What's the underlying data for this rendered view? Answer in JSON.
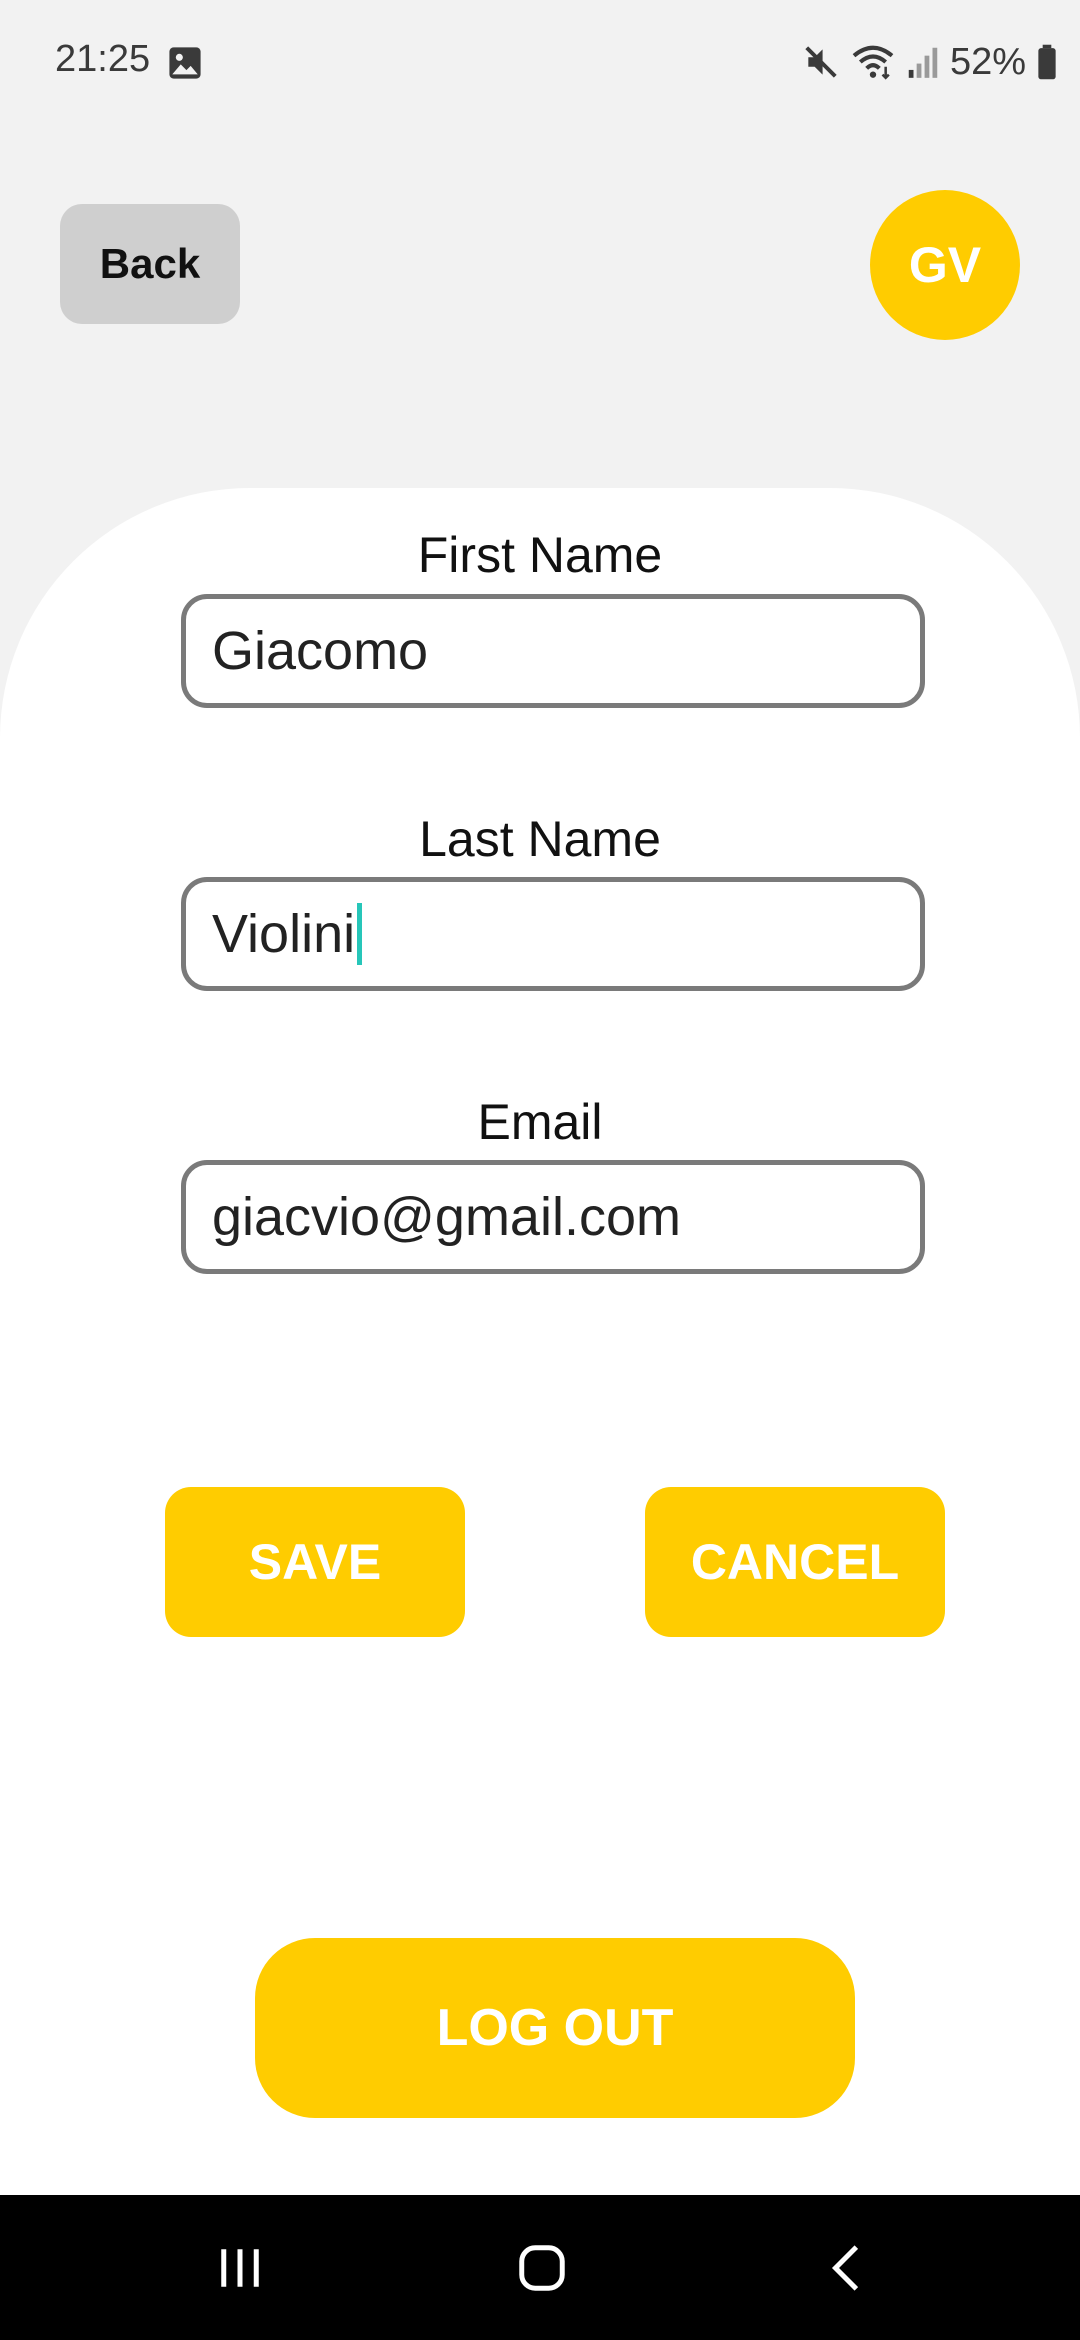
{
  "status_bar": {
    "time": "21:25",
    "battery_percent": "52%",
    "icons": [
      "gallery-icon",
      "mute-icon",
      "wifi-icon",
      "signal-icon",
      "battery-icon"
    ]
  },
  "header": {
    "back_label": "Back",
    "avatar_initials": "GV"
  },
  "form": {
    "first_name": {
      "label": "First Name",
      "value": "Giacomo"
    },
    "last_name": {
      "label": "Last Name",
      "value": "Violini"
    },
    "email": {
      "label": "Email",
      "value": "giacvio@gmail.com"
    }
  },
  "actions": {
    "save_label": "SAVE",
    "cancel_label": "CANCEL",
    "logout_label": "LOG OUT"
  },
  "nav": {
    "icons": [
      "recents-icon",
      "home-icon",
      "back-nav-icon"
    ]
  },
  "colors": {
    "accent": "#ffcc00",
    "background": "#f2f2f2",
    "card": "#ffffff",
    "caret": "#26c6b9"
  }
}
